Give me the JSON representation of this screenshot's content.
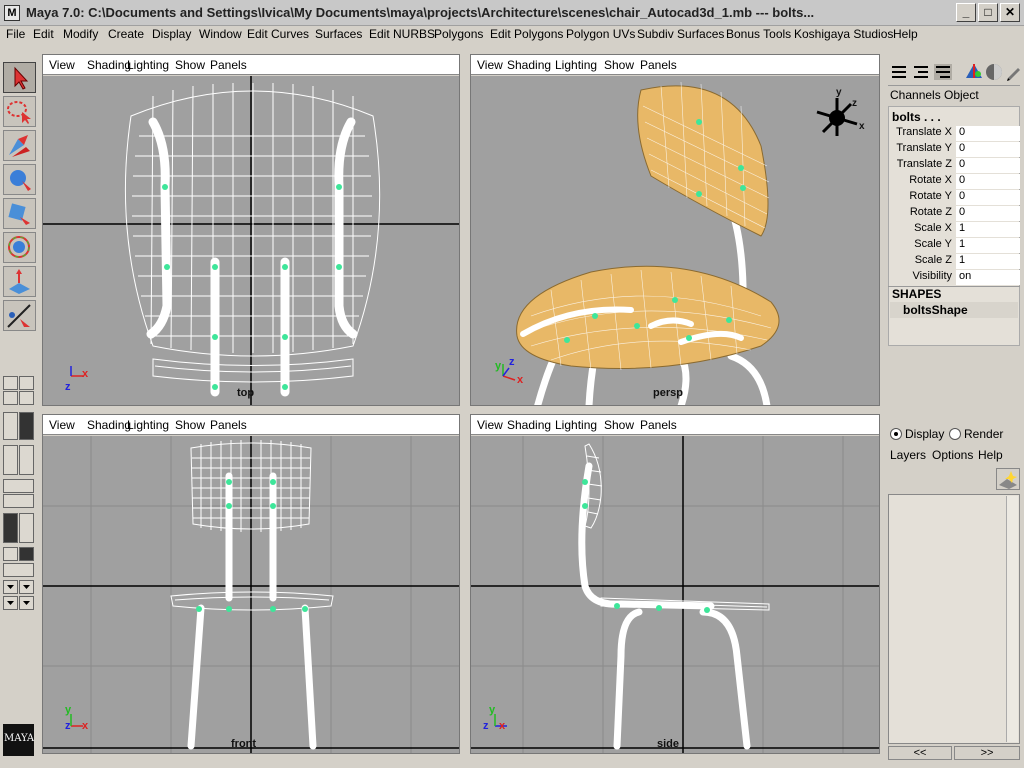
{
  "window": {
    "icon_glyph": "M",
    "title": "Maya 7.0: C:\\Documents and Settings\\Ivica\\My Documents\\maya\\projects\\Architecture\\scenes\\chair_Autocad3d_1.mb    ---    bolts...",
    "minimize_glyph": "_",
    "maximize_glyph": "□",
    "close_glyph": "✕"
  },
  "menubar": [
    "File",
    "Edit",
    "Modify",
    "Create",
    "Display",
    "Window",
    "Edit Curves",
    "Surfaces",
    "Edit NURBS",
    "Polygons",
    "Edit Polygons",
    "Polygon UVs",
    "Subdiv Surfaces",
    "Bonus Tools",
    "Koshigaya Studios",
    "Help"
  ],
  "viewports": {
    "menu": [
      "View",
      "Shading",
      "Lighting",
      "Show",
      "Panels"
    ],
    "top_label": "top",
    "persp_label": "persp",
    "front_label": "front",
    "side_label": "side",
    "axis_x": "x",
    "axis_y": "y",
    "axis_z": "z"
  },
  "channel_box": {
    "tabs": [
      "Channels",
      "Object"
    ],
    "object_name": "bolts . . .",
    "attributes": [
      {
        "label": "Translate X",
        "value": "0"
      },
      {
        "label": "Translate Y",
        "value": "0"
      },
      {
        "label": "Translate Z",
        "value": "0"
      },
      {
        "label": "Rotate X",
        "value": "0"
      },
      {
        "label": "Rotate Y",
        "value": "0"
      },
      {
        "label": "Rotate Z",
        "value": "0"
      },
      {
        "label": "Scale X",
        "value": "1"
      },
      {
        "label": "Scale Y",
        "value": "1"
      },
      {
        "label": "Scale Z",
        "value": "1"
      },
      {
        "label": "Visibility",
        "value": "on"
      }
    ],
    "shapes_header": "SHAPES",
    "shape_name": "boltsShape"
  },
  "layer_editor": {
    "display_label": "Display",
    "render_label": "Render",
    "selected_mode": "Display",
    "menu": [
      "Layers",
      "Options",
      "Help"
    ],
    "prev_glyph": "<<",
    "next_glyph": ">>"
  },
  "logo_text": "MAYA",
  "colors": {
    "viewport_bg": "#a0a0a0",
    "wireframe": "#ffffff",
    "seat_fill": "#e8b867",
    "bolt_green": "#3ee69a",
    "toolbar_bg": "#d4d0c8"
  }
}
